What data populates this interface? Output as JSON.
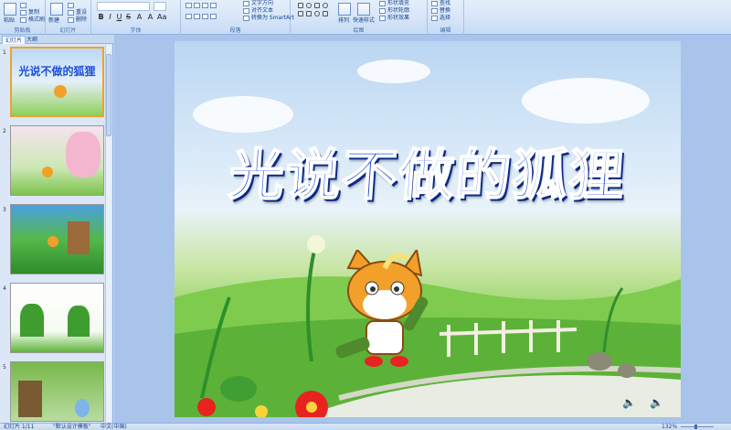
{
  "ribbon": {
    "groups": {
      "clipboard": "剪贴板",
      "slides": "幻灯片",
      "font": "字体",
      "paragraph": "段落",
      "drawing": "绘图",
      "editing": "编辑"
    },
    "paste_label": "粘贴",
    "copy_label": "复制",
    "format_painter_label": "格式刷",
    "new_slide_label": "新建\n幻灯片",
    "reset_label": "重设",
    "delete_label": "删除",
    "text_direction_label": "文字方向",
    "align_text_label": "对齐文本",
    "convert_smartart_label": "转换为 SmartArt",
    "arrange_label": "排列",
    "quick_styles_label": "快速样式",
    "shape_fill_label": "形状填充",
    "shape_outline_label": "形状轮廓",
    "shape_effects_label": "形状效果",
    "find_label": "查找",
    "replace_label": "替换",
    "select_label": "选择"
  },
  "left_panel": {
    "tabs": [
      "幻灯片",
      "大纲"
    ],
    "thumbnails": [
      {
        "number": "1",
        "caption": "光说不做的狐狸",
        "selected": true
      },
      {
        "number": "2",
        "caption": "",
        "selected": false
      },
      {
        "number": "3",
        "caption": "",
        "selected": false
      },
      {
        "number": "4",
        "caption": "",
        "selected": false
      },
      {
        "number": "5",
        "caption": "",
        "selected": false
      }
    ]
  },
  "slide": {
    "title": "光说不做的狐狸"
  },
  "statusbar": {
    "slide_info": "幻灯片 1/11",
    "theme": "\"默认设计模板\"",
    "language": "中文(中国)",
    "zoom": "132%"
  },
  "colors": {
    "title_fill": "#1f4fd8",
    "ribbon_bg": "#d6e5f8",
    "selected_thumb_border": "#f0a030"
  }
}
